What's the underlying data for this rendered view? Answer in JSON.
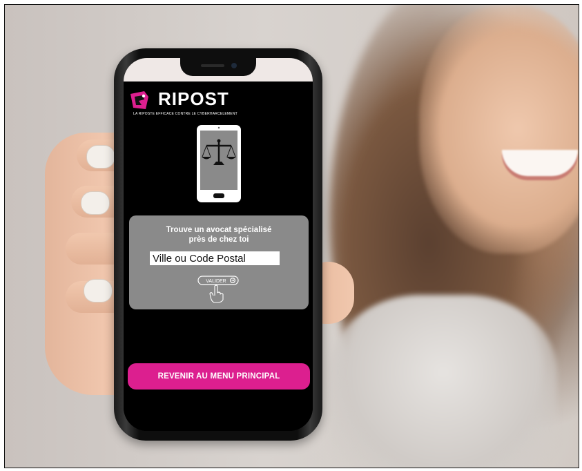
{
  "app": {
    "name": "RIPOST",
    "tagline": "LA RIPOSTE EFFICACE CONTRE LE CYBERHARCELEMENT"
  },
  "lawyer_search": {
    "title_line1": "Trouve un avocat spécialisé",
    "title_line2": "près de chez toi",
    "input_placeholder": "Ville ou Code Postal",
    "input_value": "",
    "validate_label": "VALIDER"
  },
  "navigation": {
    "main_menu_label": "REVENIR AU MENU PRINCIPAL"
  },
  "colors": {
    "accent": "#dc1f8f",
    "panel": "#8a8a8a",
    "screen_bg": "#000000"
  },
  "icons": {
    "logo": "ripost-logo-icon",
    "device": "phone-scales-icon",
    "validate": "validate-hand-icon"
  }
}
